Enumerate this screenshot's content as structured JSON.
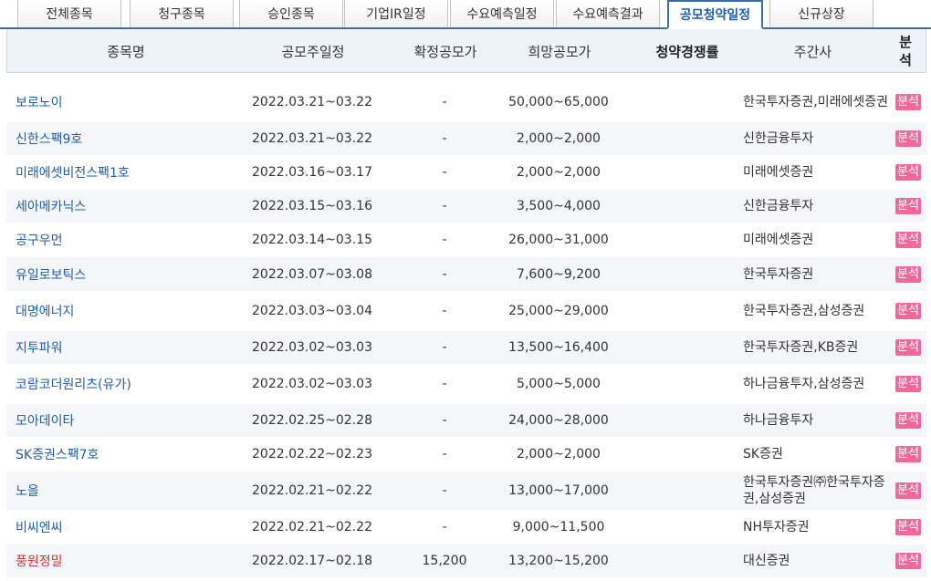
{
  "tabs": [
    "전체종목",
    "청구종목",
    "승인종목",
    "기업IR일정",
    "수요예측일정",
    "수요예측결과",
    "공모청약일정",
    "신규상장"
  ],
  "headers": {
    "name": "종목명",
    "date": "공모주일정",
    "confirmed": "확정공모가",
    "hope": "희망공모가",
    "competition": "청약경쟁률",
    "underwriter": "주간사",
    "analysis": "분석"
  },
  "rows": [
    {
      "name": "보로노이",
      "date": "2022.03.21~03.22",
      "confirmed": "-",
      "hope": "50,000~65,000",
      "competition": "",
      "underwriter": "한국투자증권,미래에셋증권",
      "analysis": "분석"
    },
    {
      "name": "신한스팩9호",
      "date": "2022.03.21~03.22",
      "confirmed": "-",
      "hope": "2,000~2,000",
      "competition": "",
      "underwriter": "신한금융투자",
      "analysis": "분석"
    },
    {
      "name": "미래에셋비전스팩1호",
      "date": "2022.03.16~03.17",
      "confirmed": "-",
      "hope": "2,000~2,000",
      "competition": "",
      "underwriter": "미래에셋증권",
      "analysis": "분석"
    },
    {
      "name": "세아메카닉스",
      "date": "2022.03.15~03.16",
      "confirmed": "-",
      "hope": "3,500~4,000",
      "competition": "",
      "underwriter": "신한금융투자",
      "analysis": "분석"
    },
    {
      "name": "공구우먼",
      "date": "2022.03.14~03.15",
      "confirmed": "-",
      "hope": "26,000~31,000",
      "competition": "",
      "underwriter": "미래에셋증권",
      "analysis": "분석"
    },
    {
      "name": "유일로보틱스",
      "date": "2022.03.07~03.08",
      "confirmed": "-",
      "hope": "7,600~9,200",
      "competition": "",
      "underwriter": "한국투자증권",
      "analysis": "분석"
    },
    {
      "name": "대명에너지",
      "date": "2022.03.03~03.04",
      "confirmed": "-",
      "hope": "25,000~29,000",
      "competition": "",
      "underwriter": "한국투자증권,삼성증권",
      "analysis": "분석"
    },
    {
      "name": "지투파워",
      "date": "2022.03.02~03.03",
      "confirmed": "-",
      "hope": "13,500~16,400",
      "competition": "",
      "underwriter": "한국투자증권,KB증권",
      "analysis": "분석"
    },
    {
      "name": "코람코더원리츠(유가)",
      "date": "2022.03.02~03.03",
      "confirmed": "-",
      "hope": "5,000~5,000",
      "competition": "",
      "underwriter": "하나금융투자,삼성증권",
      "analysis": "분석"
    },
    {
      "name": "모아데이타",
      "date": "2022.02.25~02.28",
      "confirmed": "-",
      "hope": "24,000~28,000",
      "competition": "",
      "underwriter": "하나금융투자",
      "analysis": "분석"
    },
    {
      "name": "SK증권스팩7호",
      "date": "2022.02.22~02.23",
      "confirmed": "-",
      "hope": "2,000~2,000",
      "competition": "",
      "underwriter": "SK증권",
      "analysis": "분석"
    },
    {
      "name": "노을",
      "date": "2022.02.21~02.22",
      "confirmed": "-",
      "hope": "13,000~17,000",
      "competition": "",
      "underwriter": "한국투자증권㈜한국투자증권,삼성증권",
      "analysis": "분석"
    },
    {
      "name": "비씨엔씨",
      "date": "2022.02.21~02.22",
      "confirmed": "-",
      "hope": "9,000~11,500",
      "competition": "",
      "underwriter": "NH투자증권",
      "analysis": "분석"
    },
    {
      "name": "풍원정밀",
      "date": "2022.02.17~02.18",
      "confirmed": "15,200",
      "hope": "13,200~15,200",
      "competition": "",
      "underwriter": "대신증권",
      "analysis": "분석"
    }
  ],
  "colors": {
    "accent": "#3a6ea5",
    "link": "#1f5fa8",
    "highlight_name": "#c0392b",
    "button": "#f0699a",
    "header_bg": "#eef3fa"
  }
}
